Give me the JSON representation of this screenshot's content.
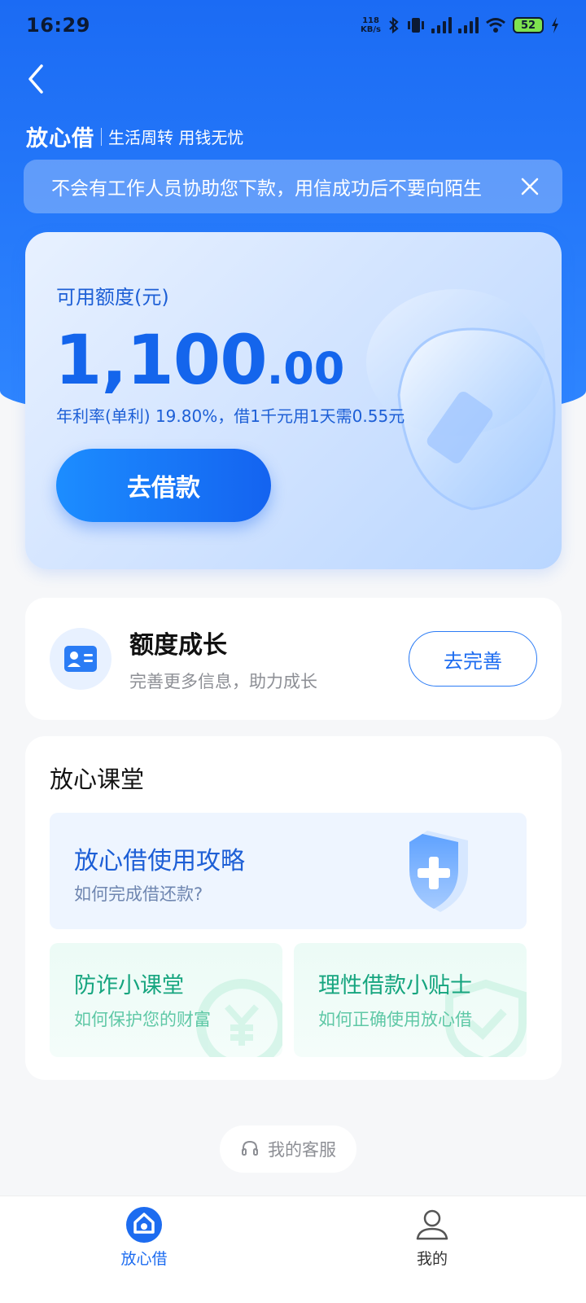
{
  "status_bar": {
    "time": "16:29",
    "net_speed_value": "118",
    "net_speed_unit": "KB/s",
    "battery": "52"
  },
  "header": {
    "brand_name": "放心借",
    "slogan": "生活周转 用钱无忧",
    "notice": "不会有工作人员协助您下款，用信成功后不要向陌生"
  },
  "credit": {
    "label": "可用额度(元)",
    "amount_int": "1,100",
    "amount_dec": ".00",
    "rate_text": "年利率(单利) 19.80%，借1千元用1天需0.55元",
    "borrow_button": "去借款"
  },
  "grow": {
    "title": "额度成长",
    "subtitle": "完善更多信息，助力成长",
    "button": "去完善"
  },
  "classroom": {
    "title": "放心课堂",
    "guide": {
      "title": "放心借使用攻略",
      "subtitle": "如何完成借还款?"
    },
    "tips": [
      {
        "title": "防诈小课堂",
        "subtitle": "如何保护您的财富"
      },
      {
        "title": "理性借款小贴士",
        "subtitle": "如何正确使用放心借"
      }
    ]
  },
  "service": {
    "label": "我的客服"
  },
  "tabbar": {
    "items": [
      {
        "label": "放心借",
        "icon": "home-logo-icon",
        "active": true
      },
      {
        "label": "我的",
        "icon": "user-icon",
        "active": false
      }
    ]
  },
  "colors": {
    "primary": "#1d6cf0",
    "accent_green": "#16a57f"
  }
}
